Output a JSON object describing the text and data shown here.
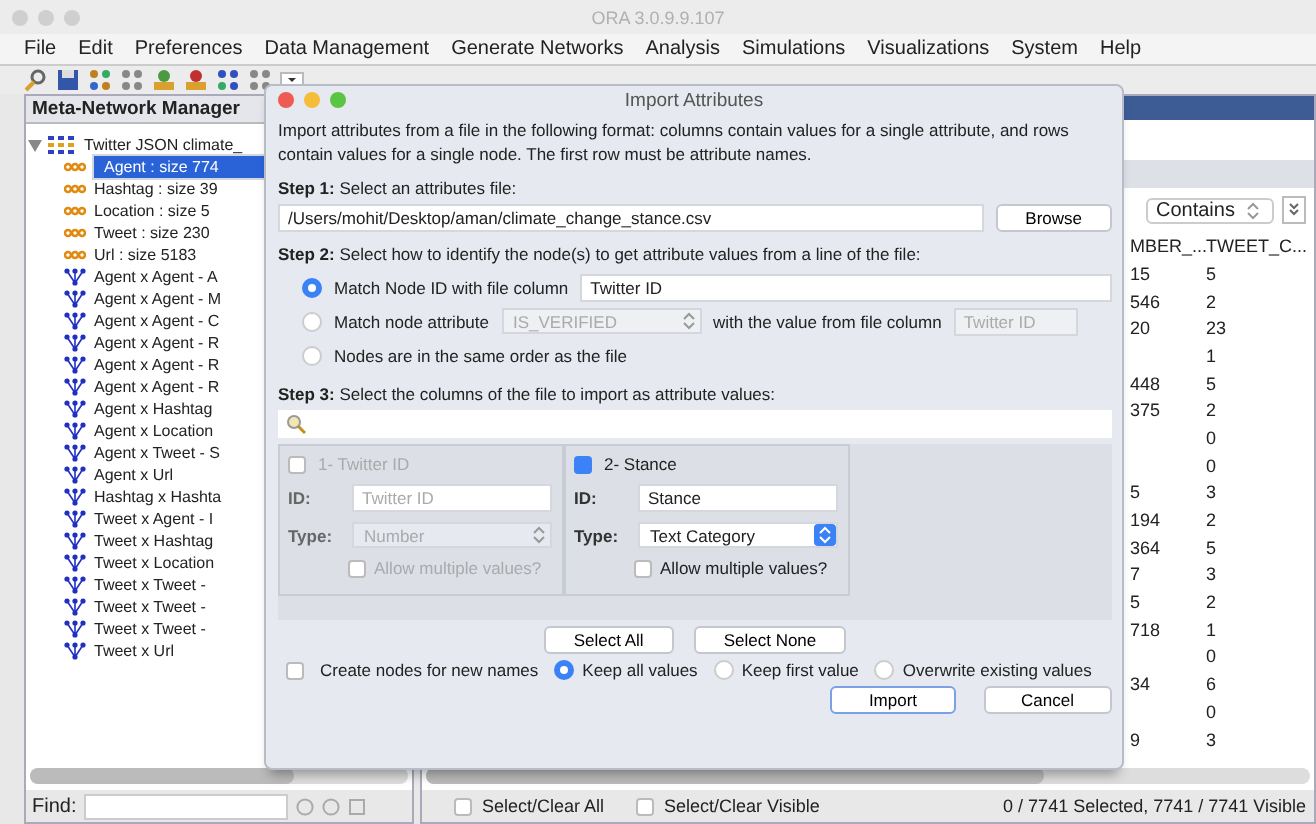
{
  "window": {
    "title": "ORA 3.0.9.9.107"
  },
  "menu": [
    "File",
    "Edit",
    "Preferences",
    "Data Management",
    "Generate Networks",
    "Analysis",
    "Simulations",
    "Visualizations",
    "System",
    "Help"
  ],
  "left_panel": {
    "title": "Meta-Network Manager",
    "tree": [
      {
        "label": "Twitter JSON climate_",
        "expanded": true,
        "kind": "meta",
        "children": [
          {
            "label": "Agent : size 774",
            "kind": "nodeset",
            "selected": true
          },
          {
            "label": "Hashtag : size 39",
            "kind": "nodeset",
            "selected": false
          },
          {
            "label": "Location : size 5",
            "kind": "nodeset",
            "selected": false
          },
          {
            "label": "Tweet : size 230",
            "kind": "nodeset",
            "selected": false
          },
          {
            "label": "Url : size 5183",
            "kind": "nodeset",
            "selected": false
          },
          {
            "label": "Agent x Agent - A",
            "kind": "network",
            "selected": false
          },
          {
            "label": "Agent x Agent - M",
            "kind": "network",
            "selected": false
          },
          {
            "label": "Agent x Agent - C",
            "kind": "network",
            "selected": false
          },
          {
            "label": "Agent x Agent - R",
            "kind": "network",
            "selected": false
          },
          {
            "label": "Agent x Agent - R",
            "kind": "network",
            "selected": false
          },
          {
            "label": "Agent x Agent - R",
            "kind": "network",
            "selected": false
          },
          {
            "label": "Agent x Hashtag",
            "kind": "network",
            "selected": false
          },
          {
            "label": "Agent x Location",
            "kind": "network",
            "selected": false
          },
          {
            "label": "Agent x Tweet - S",
            "kind": "network",
            "selected": false
          },
          {
            "label": "Agent x Url",
            "kind": "network",
            "selected": false
          },
          {
            "label": "Hashtag x Hashta",
            "kind": "network",
            "selected": false
          },
          {
            "label": "Tweet x Agent - I",
            "kind": "network",
            "selected": false
          },
          {
            "label": "Tweet x Hashtag",
            "kind": "network",
            "selected": false
          },
          {
            "label": "Tweet x Location",
            "kind": "network",
            "selected": false
          },
          {
            "label": "Tweet x Tweet -",
            "kind": "network",
            "selected": false
          },
          {
            "label": "Tweet x Tweet -",
            "kind": "network",
            "selected": false
          },
          {
            "label": "Tweet x Tweet -",
            "kind": "network",
            "selected": false
          },
          {
            "label": "Tweet x Url",
            "kind": "network",
            "selected": false
          }
        ]
      }
    ],
    "find_label": "Find:"
  },
  "right_panel": {
    "filter_mode": "Contains",
    "table": {
      "columns": [
        "MBER_...",
        "TWEET_C..."
      ],
      "rows": [
        {
          "column_1": "15",
          "column_2": "5"
        },
        {
          "column_1": "546",
          "column_2": "2"
        },
        {
          "column_1": "20",
          "column_2": "23"
        },
        {
          "column_2": "1"
        },
        {
          "column_1": "448",
          "column_2": "5"
        },
        {
          "column_1": "375",
          "column_2": "2"
        },
        {
          "column_2": "0"
        },
        {
          "column_2": "0"
        },
        {
          "column_1": "5",
          "column_2": "3"
        },
        {
          "column_1": "194",
          "column_2": "2"
        },
        {
          "column_1": "364",
          "column_2": "5"
        },
        {
          "column_1": "7",
          "column_2": "3"
        },
        {
          "column_1": "5",
          "column_2": "2"
        },
        {
          "column_1": "718",
          "column_2": "1"
        },
        {
          "column_2": "0"
        },
        {
          "column_1": "34",
          "column_2": "6"
        },
        {
          "column_2": "0"
        },
        {
          "column_1": "9",
          "column_2": "3"
        }
      ]
    },
    "select_all": {
      "label": "Select/Clear All",
      "checked": false
    },
    "select_visible": {
      "label": "Select/Clear Visible",
      "checked": false
    },
    "status": "0 / 7741 Selected, 7741 / 7741 Visible"
  },
  "dialog": {
    "title": "Import Attributes",
    "intro": "Import attributes from a file in the following format: columns contain values for a single attribute, and rows contain values for a single node. The first row must be attribute names.",
    "step1": "**Step 1:** Select an attributes file:",
    "file_path": "/Users/mohit/Desktop/aman/climate_change_stance.csv",
    "browse": "Browse",
    "step2": "**Step 2:** Select how to identify the node(s) to get attribute values from a line of the file:",
    "match_options": [
      {
        "label": "Match Node ID with file column",
        "selected": true,
        "kind": "column",
        "column": "Twitter ID"
      },
      {
        "label": "Match node attribute",
        "selected": false,
        "kind": "attribute",
        "attribute": "IS_VERIFIED",
        "connector": "with the value from file column",
        "column": "Twitter ID"
      },
      {
        "label": "Nodes are in the same order as the file",
        "selected": false,
        "kind": "order"
      }
    ],
    "step3": "**Step 3:** Select the columns of the file to import as attribute values:",
    "file_columns": [
      {
        "label": "1- Twitter ID",
        "checked": false,
        "disabled": true,
        "id_label": "ID:",
        "id": "Twitter ID",
        "type_label": "Type:",
        "type": "Number",
        "allow_multiple": "Allow multiple values?",
        "allow_multiple_checked": false
      },
      {
        "label": "2- Stance",
        "checked": true,
        "disabled": false,
        "id_label": "ID:",
        "id": "Stance",
        "type_label": "Type:",
        "type": "Text Category",
        "allow_multiple": "Allow multiple values?",
        "allow_multiple_checked": false
      }
    ],
    "select_all": "Select All",
    "select_none": "Select None",
    "create_nodes": {
      "label": "Create nodes for new names",
      "checked": false
    },
    "merge_options": [
      {
        "label": "Keep all values",
        "selected": true
      },
      {
        "label": "Keep first value",
        "selected": false
      },
      {
        "label": "Overwrite existing values",
        "selected": false
      }
    ],
    "buttons": [
      "Import",
      "Cancel"
    ]
  }
}
